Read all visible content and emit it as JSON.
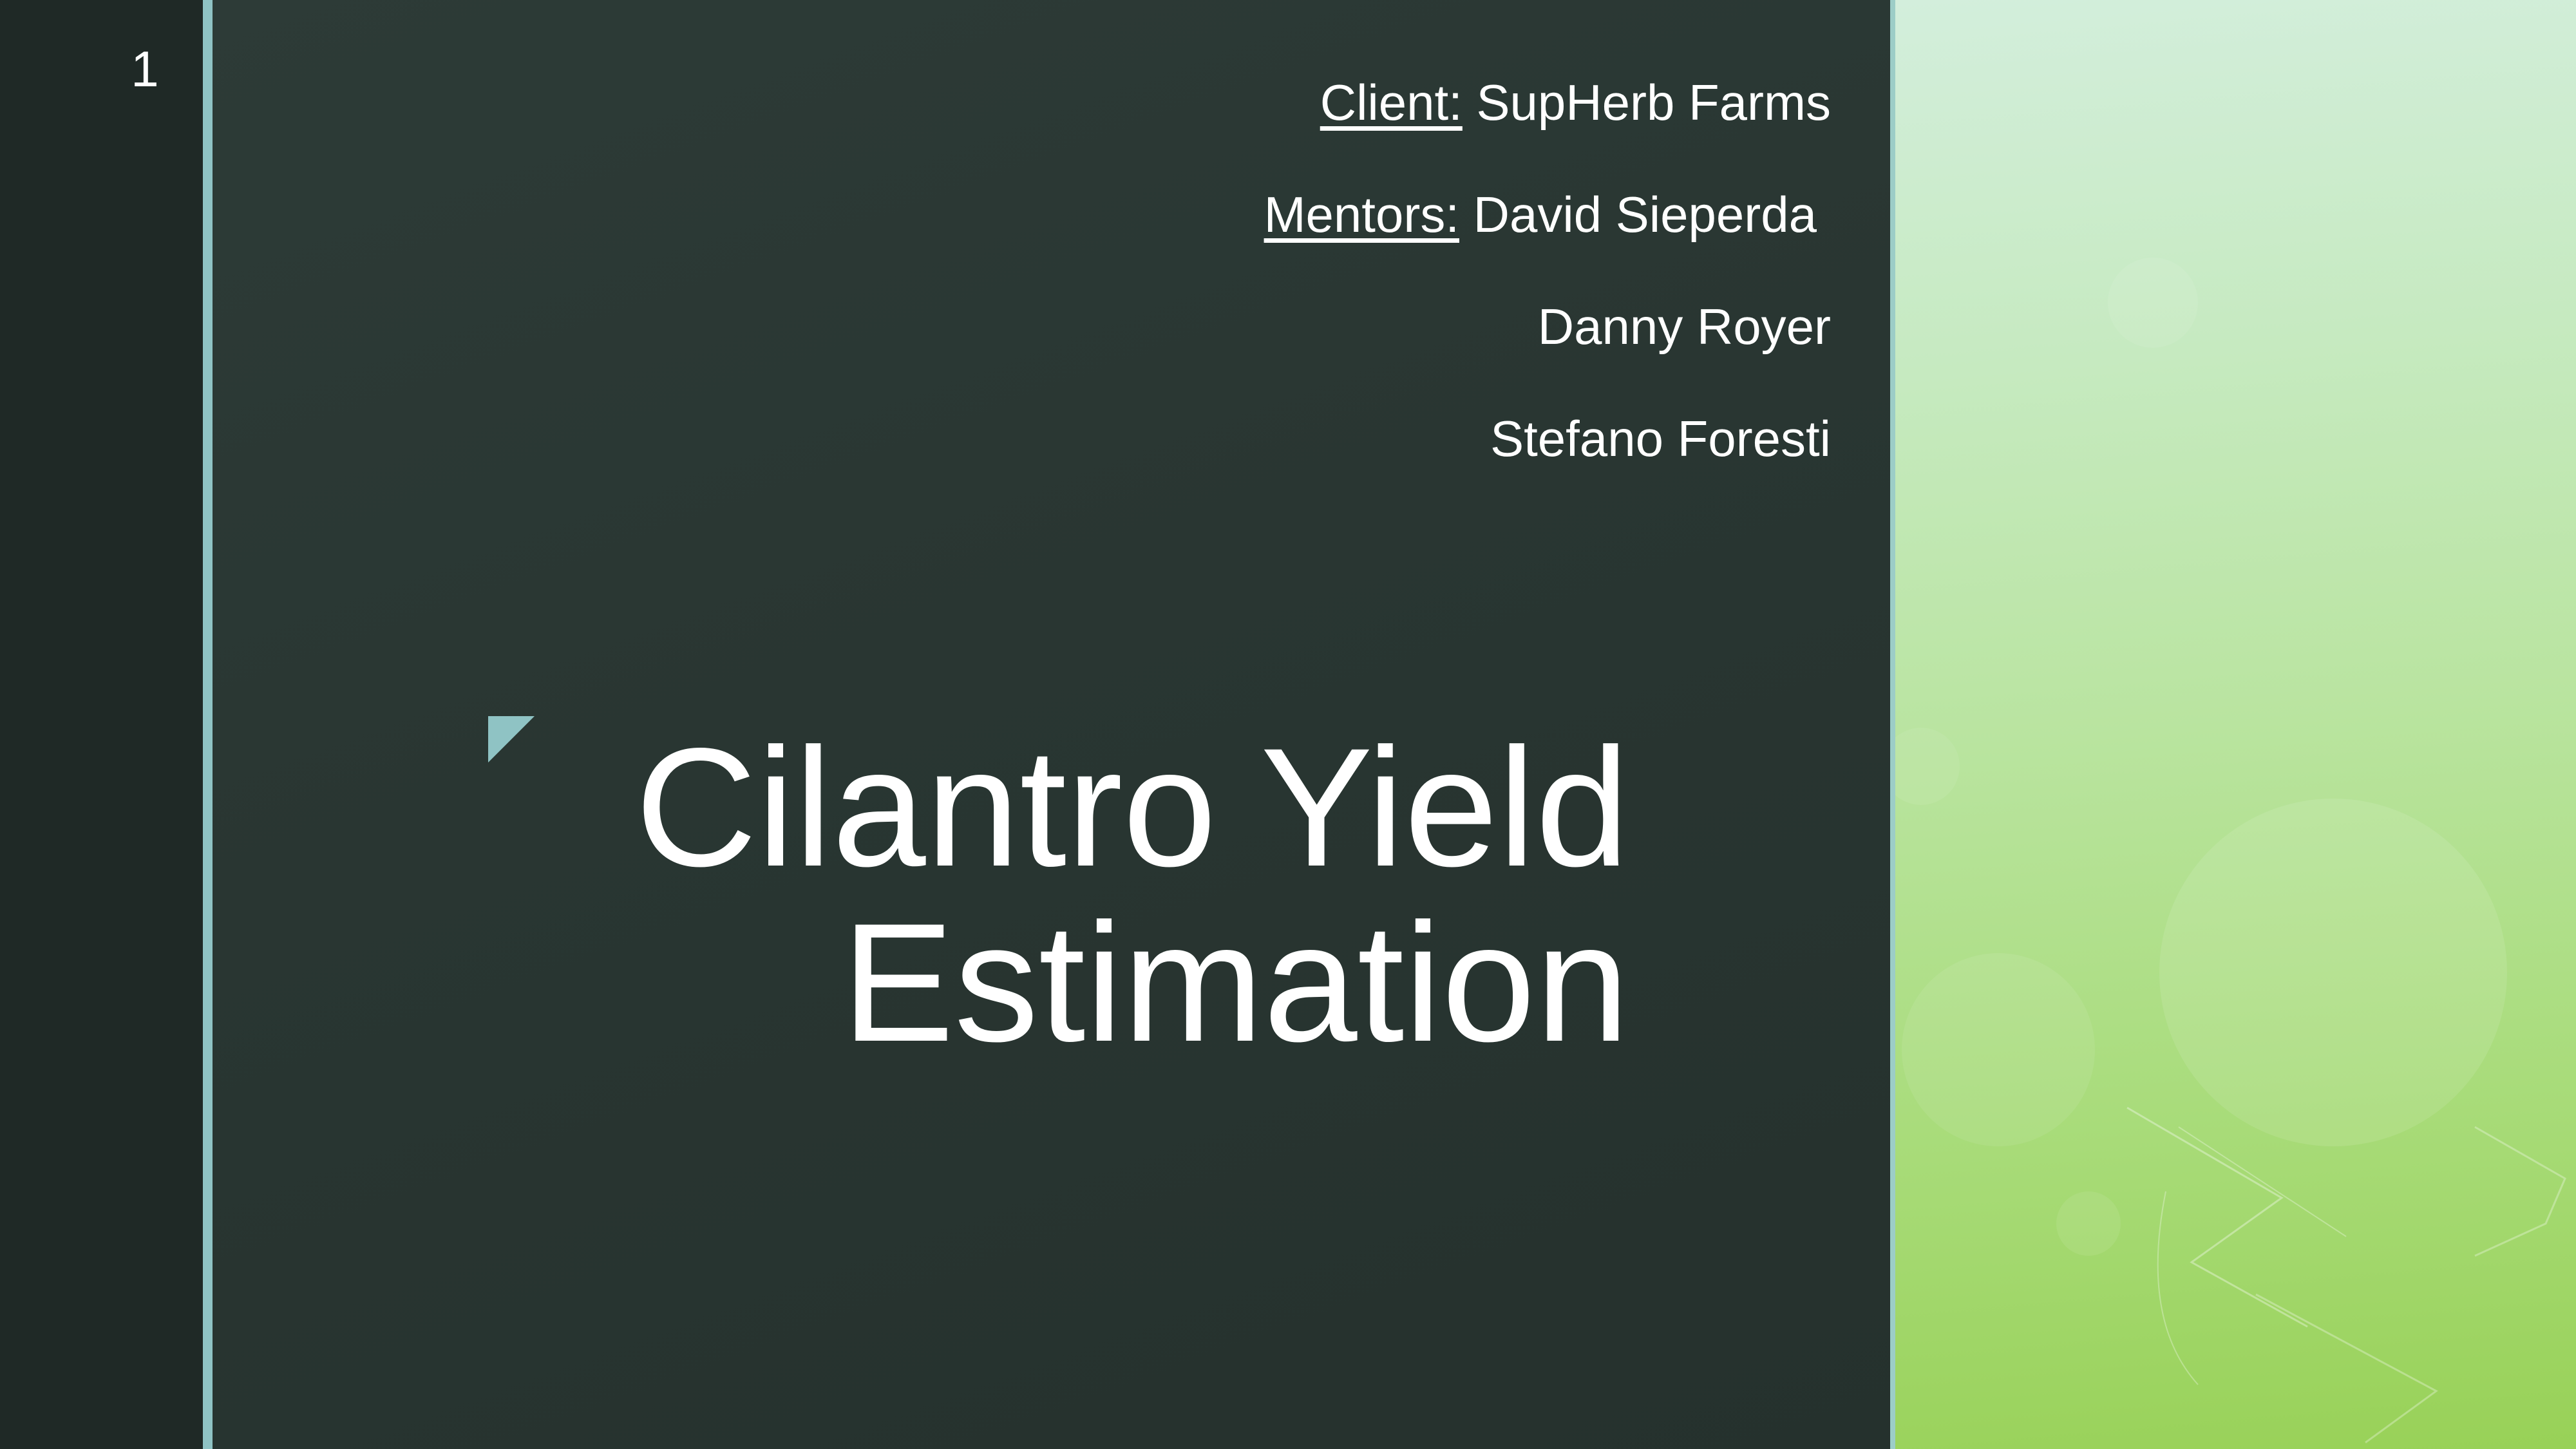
{
  "slide": {
    "page_number": "1",
    "client_label": "Client:",
    "client_name": "SupHerb Farms",
    "mentors_label": "Mentors:",
    "mentors": [
      "David Sieperda",
      "Danny Royer",
      "Stefano Foresti"
    ],
    "title_line1": "Cilantro Yield",
    "title_line2": "Estimation"
  },
  "colors": {
    "background": "#2a3733",
    "left_band": "#1f2926",
    "accent": "#8fc3c4",
    "photo_light": "#d3eedc",
    "photo_dark": "#98d157",
    "text": "#ffffff"
  },
  "icons": {
    "title_mark": "triangle-corner-icon"
  }
}
